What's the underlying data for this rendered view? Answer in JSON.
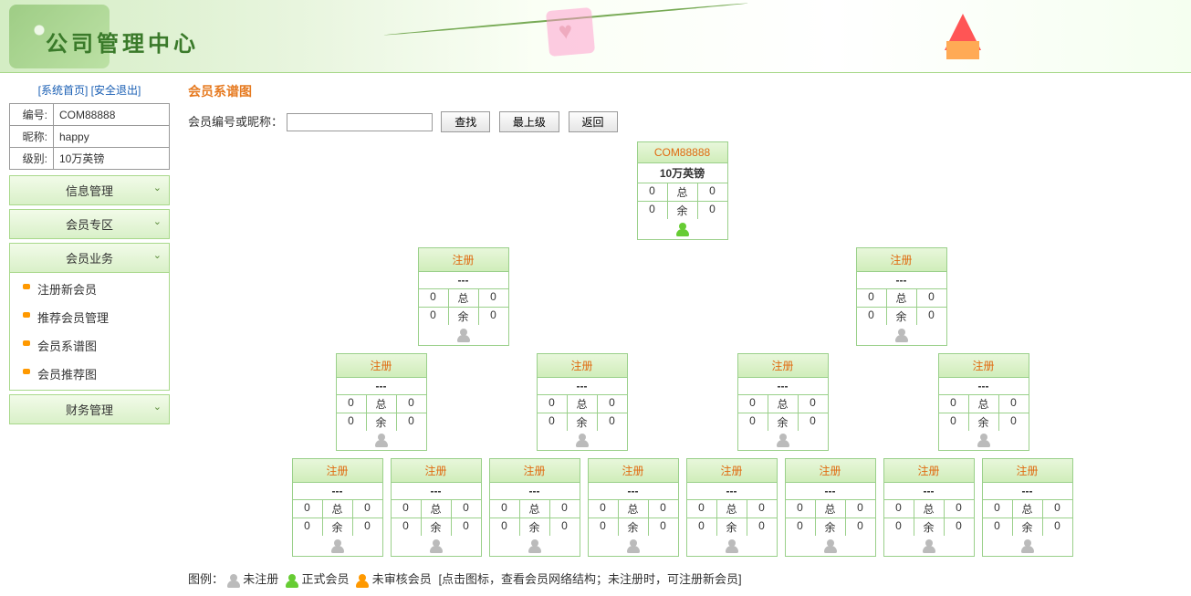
{
  "banner": {
    "title": "公司管理中心"
  },
  "top_links": {
    "home": "[系统首页]",
    "logout": "[安全退出]"
  },
  "user_info": {
    "id_label": "编号:",
    "id_value": "COM88888",
    "nick_label": "昵称:",
    "nick_value": "happy",
    "level_label": "级别:",
    "level_value": "10万英镑"
  },
  "menu": {
    "info": "信息管理",
    "member_area": "会员专区",
    "member_biz": "会员业务",
    "finance": "财务管理",
    "sub": {
      "register": "注册新会员",
      "recommend_mgmt": "推荐会员管理",
      "genealogy": "会员系谱图",
      "referral": "会员推荐图"
    }
  },
  "page": {
    "title": "会员系谱图",
    "search_label": "会员编号或昵称：",
    "search_placeholder": "",
    "btn_search": "查找",
    "btn_top": "最上级",
    "btn_back": "返回"
  },
  "labels": {
    "register": "注册",
    "dash": "---",
    "total": "总",
    "remain": "余"
  },
  "root": {
    "id": "COM88888",
    "level": "10万英镑",
    "r1a": "0",
    "r1c": "0",
    "r2a": "0",
    "r2c": "0"
  },
  "empty": {
    "a": "0",
    "c": "0"
  },
  "legend": {
    "label": "图例：",
    "unreg": "未注册",
    "formal": "正式会员",
    "pending": "未审核会员",
    "hint": "[点击图标，查看会员网络结构；未注册时，可注册新会员]"
  }
}
